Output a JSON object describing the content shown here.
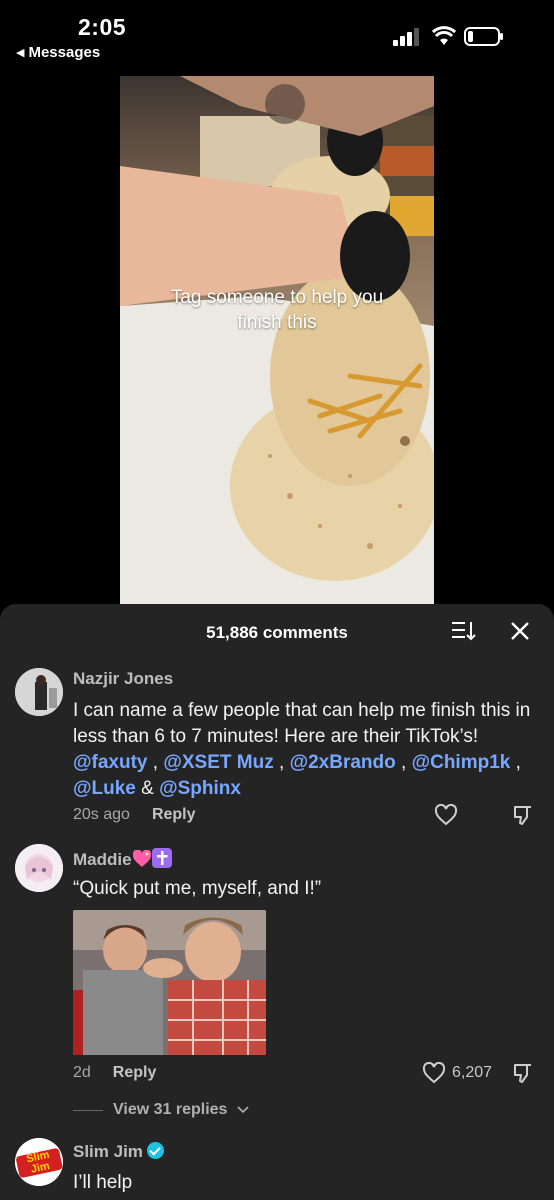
{
  "status_bar": {
    "time": "2:05",
    "back_label": "Messages"
  },
  "video": {
    "caption_line1": "Tag someone to help you",
    "caption_line2": "finish this"
  },
  "comments_header": {
    "count_label": "51,886 comments"
  },
  "comments": [
    {
      "name": "Nazjir Jones",
      "text_prefix": "I can name a few people that can help me finish this in less than 6 to 7 minutes! Here are their TikTok’s! ",
      "mentions": [
        "@faxuty",
        "@XSET Muz",
        "@2xBrando",
        "@Chimp1k",
        "@Luke",
        "@Sphinx"
      ],
      "separators": [
        " , ",
        " , ",
        " , ",
        " , ",
        " & "
      ],
      "time": "20s ago",
      "reply_label": "Reply"
    },
    {
      "name": "Maddie",
      "name_emojis": [
        "sparkling-heart",
        "latin-cross"
      ],
      "text": "“Quick put me, myself, and I!”",
      "time": "2d",
      "reply_label": "Reply",
      "likes": "6,207",
      "view_replies": "View 31 replies"
    },
    {
      "name": "Slim Jim",
      "verified": true,
      "avatar_text": "Slim Jim",
      "text": "I’ll help"
    }
  ],
  "colors": {
    "sheet_bg": "#242424",
    "mention": "#78a7ff",
    "verified": "#20c0e0"
  }
}
